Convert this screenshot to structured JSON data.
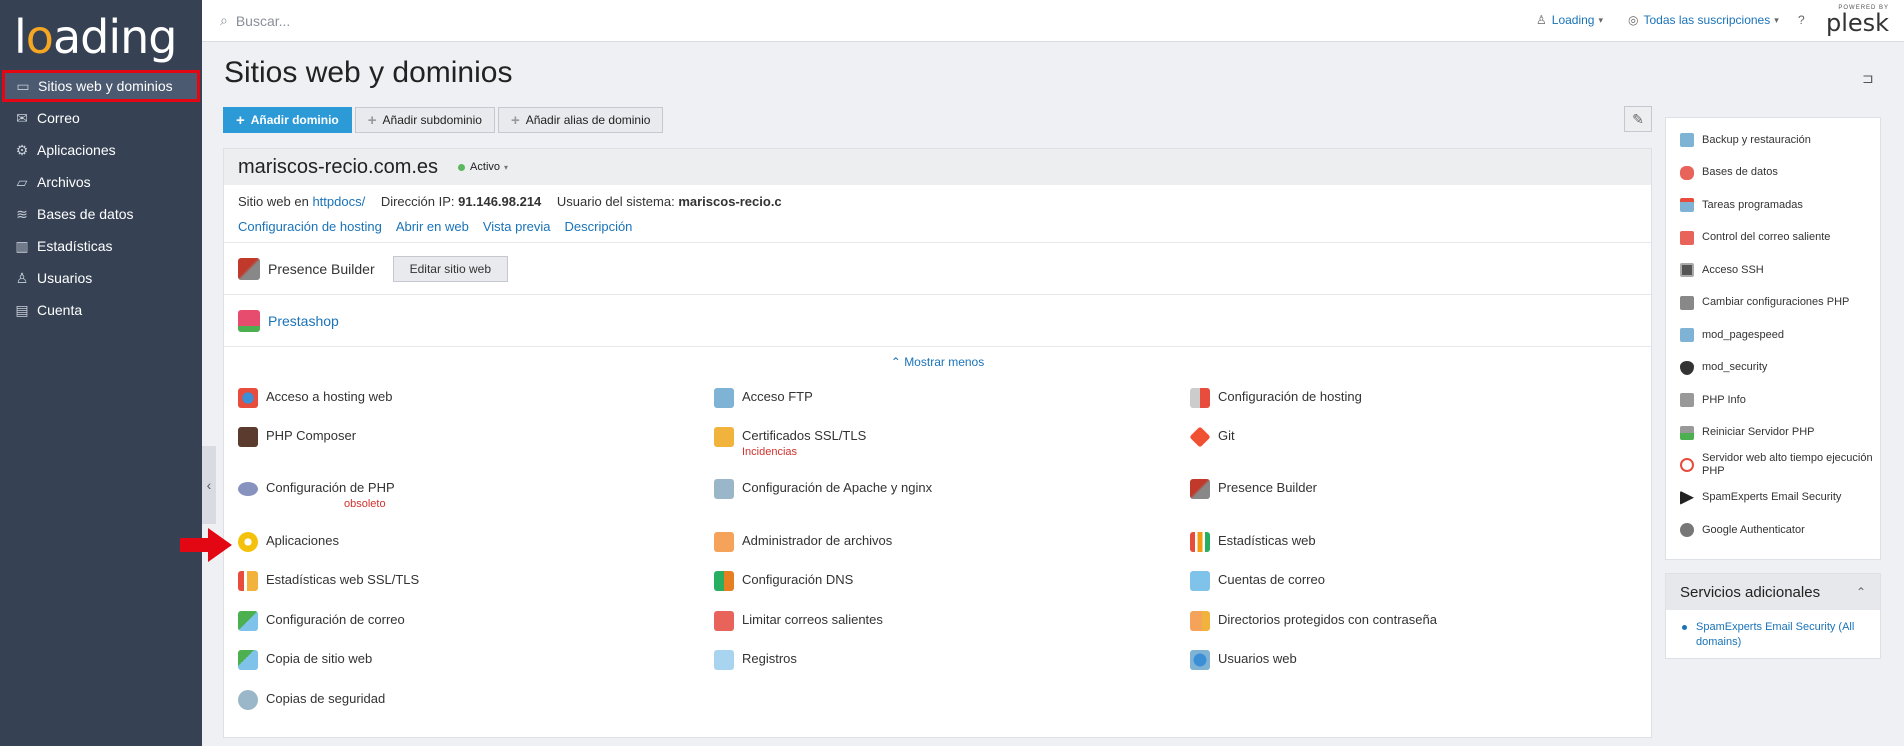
{
  "brand": {
    "logo_text": "loading",
    "accent": "#f5a623",
    "plesk_small": "POWERED BY",
    "plesk_big": "plesk"
  },
  "sidebar": {
    "items": [
      {
        "label": "Sitios web y dominios",
        "icon": "monitor-icon",
        "active": true
      },
      {
        "label": "Correo",
        "icon": "mail-icon"
      },
      {
        "label": "Aplicaciones",
        "icon": "gear-icon"
      },
      {
        "label": "Archivos",
        "icon": "folder-icon"
      },
      {
        "label": "Bases de datos",
        "icon": "layers-icon"
      },
      {
        "label": "Estadísticas",
        "icon": "bar-chart-icon"
      },
      {
        "label": "Usuarios",
        "icon": "user-icon"
      },
      {
        "label": "Cuenta",
        "icon": "briefcase-icon"
      }
    ]
  },
  "topbar": {
    "search_placeholder": "Buscar...",
    "user": "Loading",
    "subscriptions": "Todas las suscripciones"
  },
  "page": {
    "title": "Sitios web y dominios"
  },
  "toolbar": {
    "add_domain": "Añadir dominio",
    "add_subdomain": "Añadir subdominio",
    "add_alias": "Añadir alias de dominio"
  },
  "domain": {
    "name": "mariscos-recio.com.es",
    "status": "Activo",
    "site_prefix": "Sitio web en ",
    "site_dir": "httpdocs/",
    "ip_label": "Dirección IP:",
    "ip": "91.146.98.214",
    "sysuser_label": "Usuario del sistema:",
    "sysuser": "mariscos-recio.c",
    "links": [
      "Configuración de hosting",
      "Abrir en web",
      "Vista previa",
      "Descripción"
    ],
    "presence": "Presence Builder",
    "edit_site": "Editar sitio web",
    "prestashop": "Prestashop",
    "show_less": "Mostrar menos"
  },
  "tools": [
    {
      "label": "Acceso a hosting web",
      "sub": ""
    },
    {
      "label": "Acceso FTP",
      "sub": ""
    },
    {
      "label": "Configuración de hosting",
      "sub": ""
    },
    {
      "label": "PHP Composer",
      "sub": ""
    },
    {
      "label": "Certificados SSL/TLS",
      "sub": "Incidencias"
    },
    {
      "label": "Git",
      "sub": ""
    },
    {
      "label": "Configuración de PHP",
      "sub": "obsoleto"
    },
    {
      "label": "Configuración de Apache y nginx",
      "sub": ""
    },
    {
      "label": "Presence Builder",
      "sub": ""
    },
    {
      "label": "Aplicaciones",
      "sub": ""
    },
    {
      "label": "Administrador de archivos",
      "sub": ""
    },
    {
      "label": "Estadísticas web",
      "sub": ""
    },
    {
      "label": "Estadísticas web SSL/TLS",
      "sub": ""
    },
    {
      "label": "Configuración DNS",
      "sub": ""
    },
    {
      "label": "Cuentas de correo",
      "sub": ""
    },
    {
      "label": "Configuración de correo",
      "sub": ""
    },
    {
      "label": "Limitar correos salientes",
      "sub": ""
    },
    {
      "label": "Directorios protegidos con contraseña",
      "sub": ""
    },
    {
      "label": "Copia de sitio web",
      "sub": ""
    },
    {
      "label": "Registros",
      "sub": ""
    },
    {
      "label": "Usuarios web",
      "sub": ""
    },
    {
      "label": "Copias de seguridad",
      "sub": ""
    }
  ],
  "right": {
    "items": [
      "Backup y restauración",
      "Bases de datos",
      "Tareas programadas",
      "Control del correo saliente",
      "Acceso SSH",
      "Cambiar configuraciones PHP",
      "mod_pagespeed",
      "mod_security",
      "PHP Info",
      "Reiniciar Servidor PHP",
      "Servidor web alto tiempo ejecución PHP",
      "SpamExperts Email Security",
      "Google Authenticator"
    ],
    "extra_title": "Servicios adicionales",
    "extra_item": "SpamExperts Email Security (All domains)"
  }
}
